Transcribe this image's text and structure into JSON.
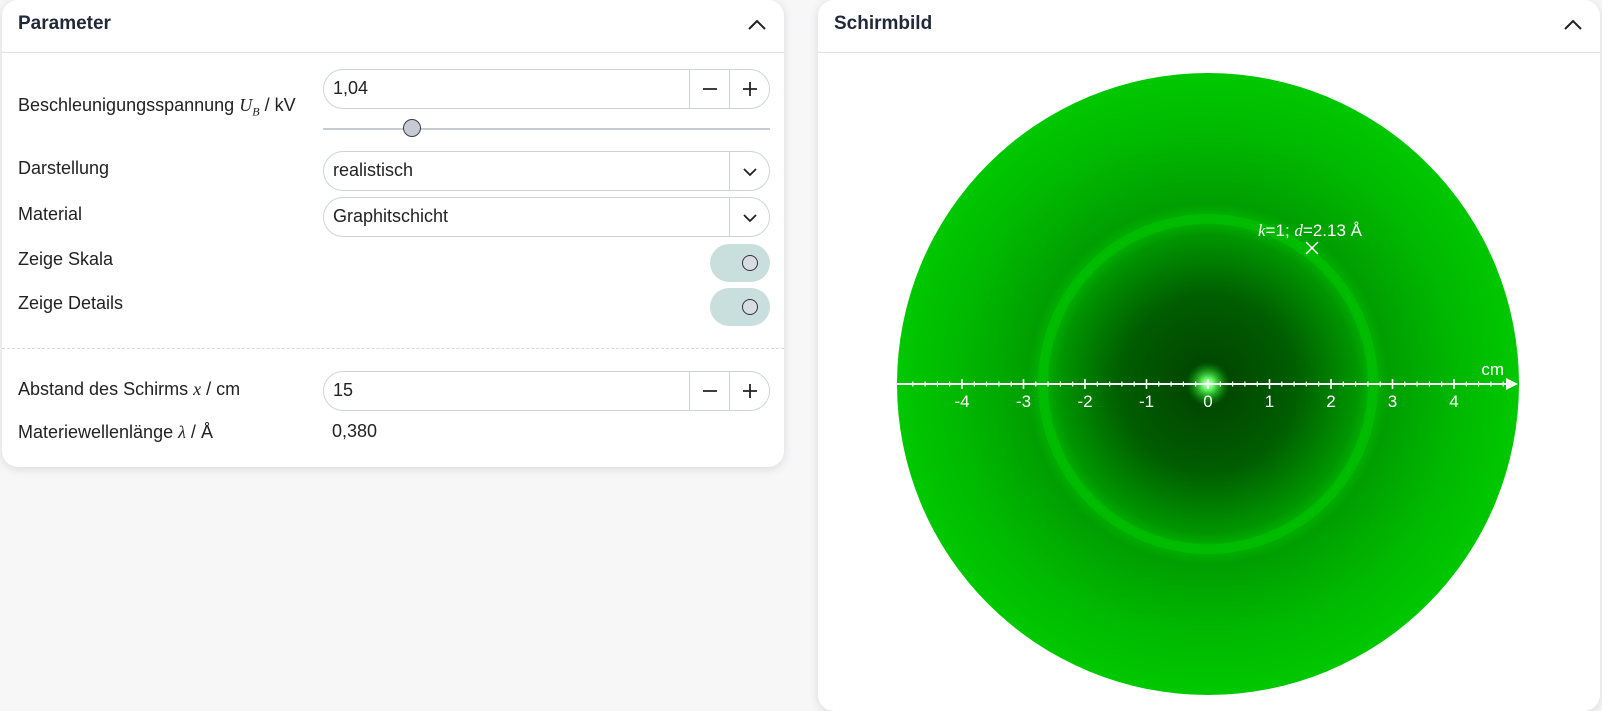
{
  "parameter_panel": {
    "title": "Parameter",
    "rows": {
      "voltage": {
        "label": "Beschleunigungsspannung",
        "symbol": "U",
        "subscript": "B",
        "unit_sep": "/",
        "unit": "kV",
        "value": "1,04",
        "slider_fraction": 0.2
      },
      "display": {
        "label": "Darstellung",
        "value": "realistisch"
      },
      "material": {
        "label": "Material",
        "value": "Graphitschicht"
      },
      "show_scale": {
        "label": "Zeige Skala",
        "on": true
      },
      "show_details": {
        "label": "Zeige Details",
        "on": true
      },
      "distance": {
        "label": "Abstand des Schirms",
        "symbol": "x",
        "unit_sep": "/",
        "unit": "cm",
        "value": "15"
      },
      "wavelength": {
        "label": "Materiewellenlänge",
        "symbol": "λ",
        "unit_sep": "/",
        "unit": "Å",
        "value": "0,380"
      }
    }
  },
  "screen_panel": {
    "title": "Schirmbild",
    "axis": {
      "ticks": [
        "-4",
        "-3",
        "-2",
        "-1",
        "0",
        "1",
        "2",
        "3",
        "4"
      ],
      "unit": "cm"
    },
    "annotation": {
      "k_symbol": "k",
      "k_value": "1",
      "d_symbol": "d",
      "d_value": "2.13",
      "d_unit": "Å"
    }
  },
  "colors": {
    "screen_green": "#00c800",
    "screen_dark": "#004a00",
    "toggle_bg": "#c9dfdd"
  }
}
